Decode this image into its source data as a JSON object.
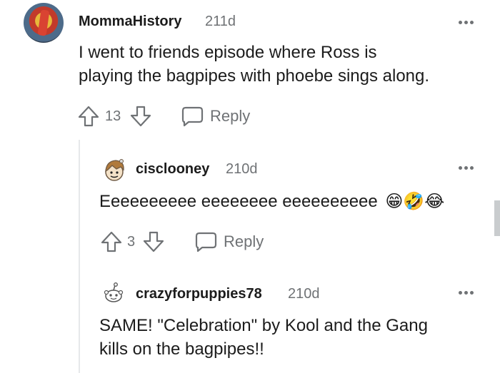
{
  "comments": [
    {
      "username": "MommaHistory",
      "age": "211d",
      "text_line1": "I went to friends episode where Ross is",
      "text_line2": "playing the bagpipes with phoebe sings along.",
      "votes": "13",
      "reply_label": "Reply"
    },
    {
      "username": "cisclooney",
      "age": "210d",
      "text": "Eeeeeeeeee eeeeeeee eeeeeeeeee",
      "emojis": "😁🤣😂",
      "votes": "3",
      "reply_label": "Reply"
    },
    {
      "username": "crazyforpuppies78",
      "age": "210d",
      "text_line1": "SAME! \"Celebration\" by Kool and the Gang",
      "text_line2": "kills on the bagpipes!!"
    }
  ],
  "colors": {
    "text": "#1c1c1c",
    "meta": "#6f7275",
    "thread_line": "#e6e8ea"
  },
  "icons": [
    "overflow-menu-icon",
    "upvote-arrow-icon",
    "downvote-arrow-icon",
    "reply-bubble-icon",
    "snoo-avatar-icon"
  ]
}
